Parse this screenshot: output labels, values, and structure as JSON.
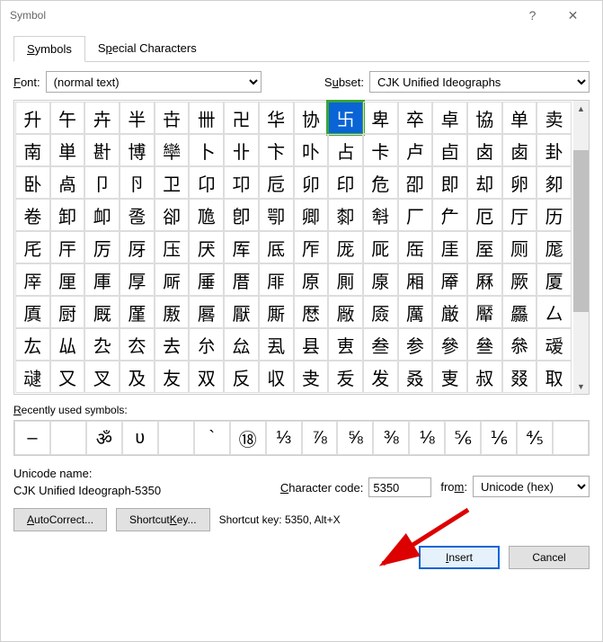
{
  "title": "Symbol",
  "tabs": {
    "symbols": "Symbols",
    "special": "Special Characters"
  },
  "labels": {
    "font": "Font:",
    "subset": "Subset:",
    "recent": "Recently used symbols:",
    "uname": "Unicode name:",
    "code": "Character code:",
    "from": "from:",
    "shortcut_prefix": "Shortcut key:"
  },
  "font_value": "(normal text)",
  "subset_value": "CJK Unified Ideographs",
  "grid": [
    "升",
    "午",
    "卉",
    "半",
    "卋",
    "卌",
    "卍",
    "华",
    "协",
    "卐",
    "卑",
    "卒",
    "卓",
    "協",
    "单",
    "卖",
    "南",
    "単",
    "卙",
    "博",
    "卛",
    "卜",
    "卝",
    "卞",
    "卟",
    "占",
    "卡",
    "卢",
    "卣",
    "卤",
    "卥",
    "卦",
    "卧",
    "卨",
    "卩",
    "卪",
    "卫",
    "卬",
    "卭",
    "卮",
    "卯",
    "印",
    "危",
    "卲",
    "即",
    "却",
    "卵",
    "卶",
    "卷",
    "卸",
    "卹",
    "卺",
    "卻",
    "卼",
    "卽",
    "卾",
    "卿",
    "厀",
    "厁",
    "厂",
    "厃",
    "厄",
    "厅",
    "历",
    "厇",
    "厈",
    "厉",
    "厊",
    "压",
    "厌",
    "厍",
    "厎",
    "厏",
    "厐",
    "厑",
    "厒",
    "厓",
    "厔",
    "厕",
    "厖",
    "厗",
    "厘",
    "厙",
    "厚",
    "厛",
    "厜",
    "厝",
    "厞",
    "原",
    "厠",
    "厡",
    "厢",
    "厣",
    "厤",
    "厥",
    "厦",
    "厧",
    "厨",
    "厩",
    "厪",
    "厫",
    "厬",
    "厭",
    "厮",
    "厯",
    "厰",
    "厱",
    "厲",
    "厳",
    "厴",
    "厵",
    "厶",
    "厷",
    "厸",
    "厹",
    "厺",
    "去",
    "厼",
    "厽",
    "厾",
    "县",
    "叀",
    "叁",
    "参",
    "參",
    "叄",
    "叅",
    "叆",
    "叇",
    "又",
    "叉",
    "及",
    "友",
    "双",
    "反",
    "収",
    "叏",
    "叐",
    "发",
    "叒",
    "叓",
    "叔",
    "叕",
    "取"
  ],
  "selected_index": 9,
  "recent": [
    "–",
    "",
    "ॐ",
    "ʋ",
    "",
    "`",
    "⑱",
    "⅓",
    "⅞",
    "⅝",
    "⅜",
    "⅛",
    "⅚",
    "⅙",
    "⅘",
    ""
  ],
  "unicode_name": "CJK Unified Ideograph-5350",
  "char_code": "5350",
  "from_value": "Unicode (hex)",
  "shortcut_key": "5350, Alt+X",
  "buttons": {
    "autocorrect": "AutoCorrect...",
    "shortcut": "Shortcut Key...",
    "insert": "Insert",
    "cancel": "Cancel"
  }
}
